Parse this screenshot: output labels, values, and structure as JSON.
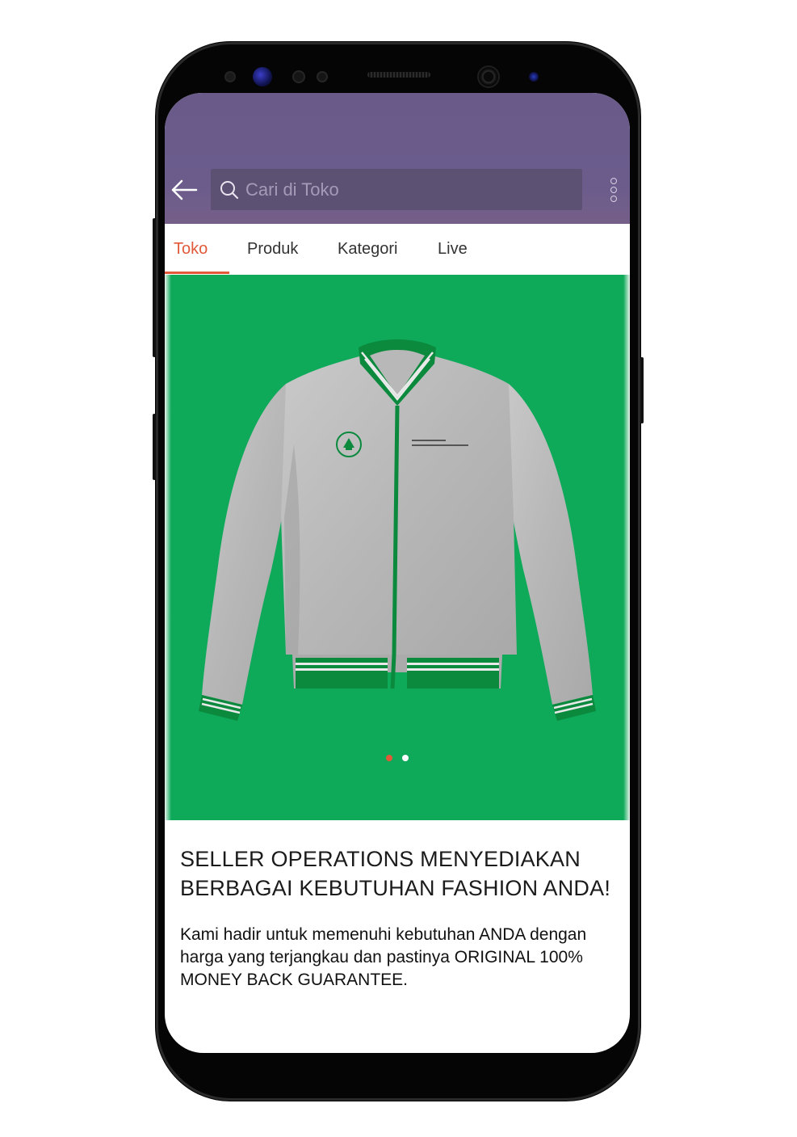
{
  "app": {
    "search": {
      "placeholder": "Cari di Toko"
    },
    "tabs": [
      {
        "label": "Toko",
        "active": true
      },
      {
        "label": "Produk",
        "active": false
      },
      {
        "label": "Kategori",
        "active": false
      },
      {
        "label": "Live",
        "active": false
      }
    ],
    "banner": {
      "background_color": "#0fa95a",
      "image": "grey bomber jacket with green ribbed collar, cuffs and hem",
      "slide_count": 2,
      "active_slide": 1
    },
    "headline": "SELLER OPERATIONS MENYEDIAKAN BERBAGAI KEBUTUHAN FASHION ANDA!",
    "description": "Kami hadir untuk memenuhi kebutuhan ANDA dengan harga yang terjangkau dan pastinya ORIGINAL 100% MONEY BACK GUARANTEE."
  },
  "colors": {
    "header": "#695a8a",
    "accent": "#e2593a",
    "banner": "#0fa95a"
  },
  "icons": [
    "back-arrow-icon",
    "search-icon",
    "more-options-icon"
  ]
}
